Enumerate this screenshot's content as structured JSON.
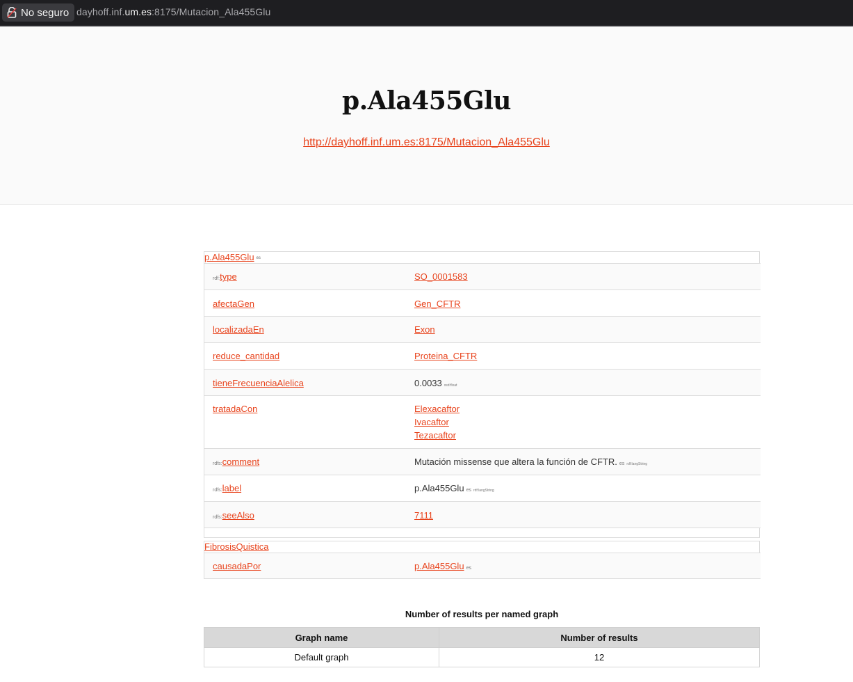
{
  "browser": {
    "security_label": "No seguro",
    "url_prefix": "dayhoff.inf.",
    "url_domain": "um.es",
    "url_suffix": ":8175/Mutacion_Ala455Glu"
  },
  "header": {
    "title": "p.Ala455Glu",
    "uri": "http://dayhoff.inf.um.es:8175/Mutacion_Ala455Glu"
  },
  "subject_block": {
    "subject": "p.Ala455Glu",
    "subject_lang": "es",
    "rows": [
      {
        "prefix": "rdf:",
        "predicate": "type",
        "objects": [
          "SO_0001583"
        ]
      },
      {
        "prefix": "",
        "predicate": "afectaGen",
        "objects": [
          "Gen_CFTR"
        ]
      },
      {
        "prefix": "",
        "predicate": "localizadaEn",
        "objects": [
          "Exon"
        ]
      },
      {
        "prefix": "",
        "predicate": "reduce_cantidad",
        "objects": [
          "Proteina_CFTR"
        ]
      },
      {
        "prefix": "",
        "predicate": "tieneFrecuenciaAlelica",
        "literal": "0.0033",
        "datatype": "xsd:float"
      },
      {
        "prefix": "",
        "predicate": "tratadaCon",
        "objects": [
          "Elexacaftor",
          "Ivacaftor",
          "Tezacaftor"
        ]
      },
      {
        "prefix": "rdfs:",
        "predicate": "comment",
        "literal": "Mutación missense que altera la función de CFTR.",
        "lang": "es",
        "datatype": "rdf:langString"
      },
      {
        "prefix": "rdfs:",
        "predicate": "label",
        "literal": "p.Ala455Glu",
        "lang": "es",
        "datatype": "rdf:langString"
      },
      {
        "prefix": "rdfs:",
        "predicate": "seeAlso",
        "objects": [
          "7111"
        ]
      }
    ]
  },
  "incoming_block": {
    "subject": "FibrosisQuistica",
    "rows": [
      {
        "predicate": "causadaPor",
        "object": "p.Ala455Glu",
        "lang": "es"
      }
    ]
  },
  "results": {
    "title": "Number of results per named graph",
    "headers": [
      "Graph name",
      "Number of results"
    ],
    "rows": [
      [
        "Default graph",
        "12"
      ]
    ]
  }
}
